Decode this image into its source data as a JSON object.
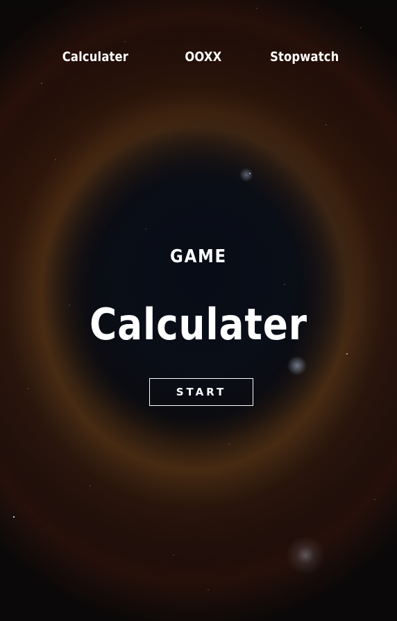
{
  "nav": {
    "items": [
      {
        "label": "Calculater"
      },
      {
        "label": "OOXX"
      },
      {
        "label": "Stopwatch"
      }
    ]
  },
  "hero": {
    "kicker": "GAME",
    "title": "Calculater",
    "start_label": "START"
  },
  "colors": {
    "text": "#ffffff",
    "background": "#0a0a0f",
    "nebula_accent": "#8a5a22"
  }
}
